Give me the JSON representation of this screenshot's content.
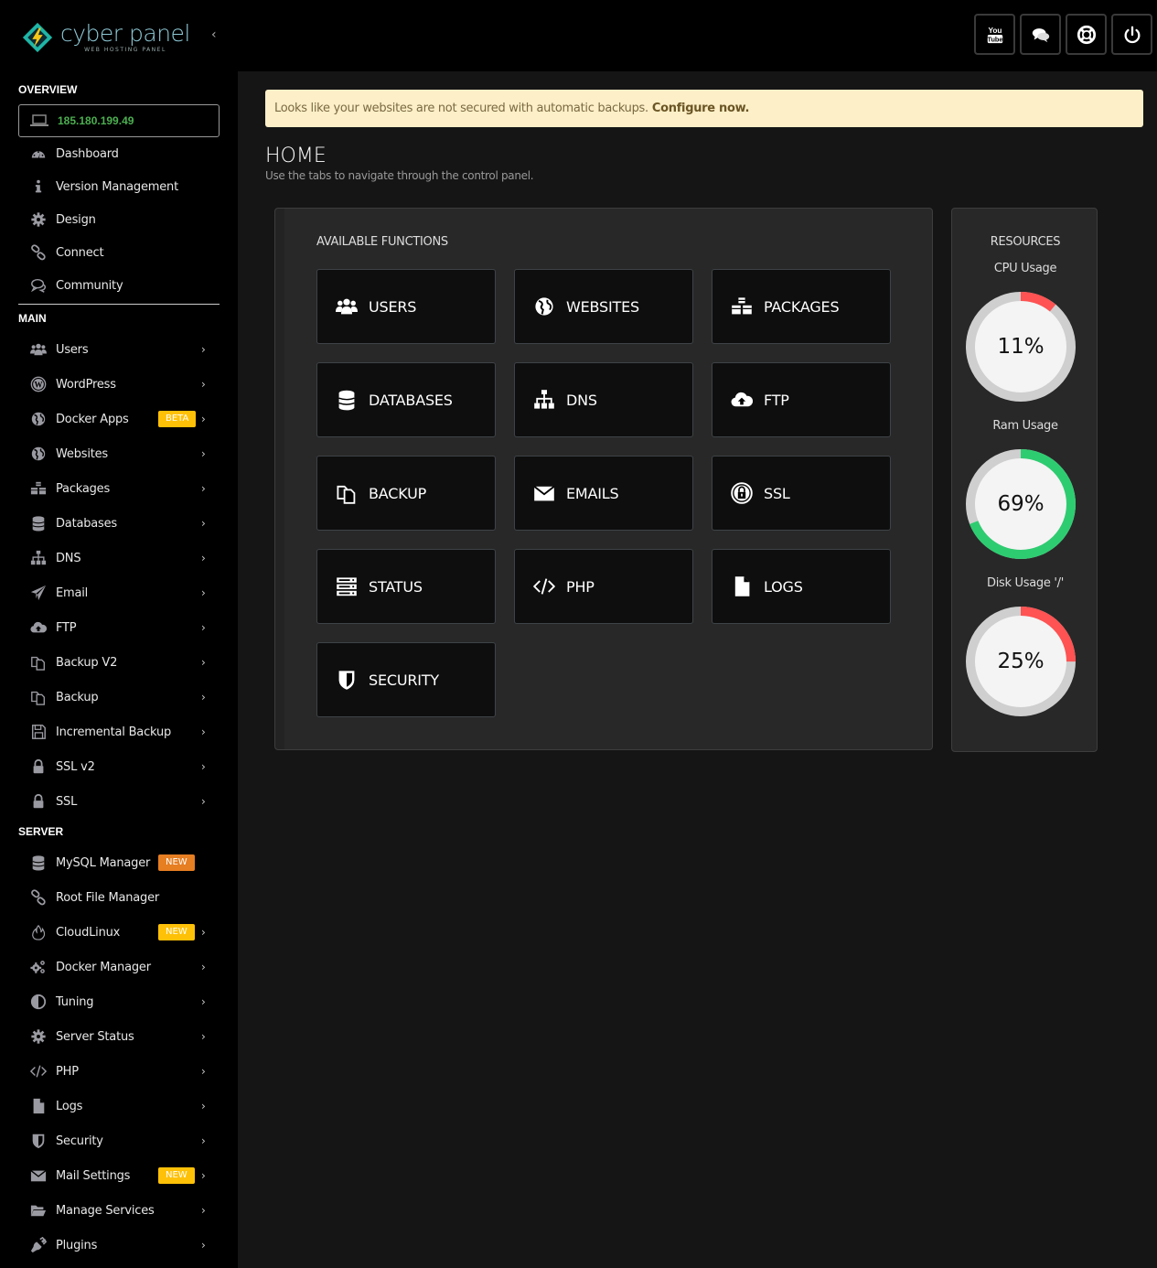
{
  "brand": {
    "name": "cyber panel",
    "tagline": "WEB HOSTING PANEL",
    "collapse_icon": "chevron-left-icon"
  },
  "top_actions": [
    {
      "name": "youtube-button",
      "icon": "youtube-icon"
    },
    {
      "name": "community-chat-button",
      "icon": "chat-bubbles-icon"
    },
    {
      "name": "support-button",
      "icon": "lifebuoy-icon"
    },
    {
      "name": "logout-button",
      "icon": "power-icon"
    }
  ],
  "sidebar": {
    "overview_title": "OVERVIEW",
    "ip_address": "185.180.199.49",
    "overview_items": [
      {
        "label": "Dashboard",
        "icon": "dashboard-gauge-icon"
      },
      {
        "label": "Version Management",
        "icon": "info-icon"
      },
      {
        "label": "Design",
        "icon": "gear-icon"
      },
      {
        "label": "Connect",
        "icon": "link-icon"
      },
      {
        "label": "Community",
        "icon": "comments-icon"
      }
    ],
    "main_title": "MAIN",
    "main_items": [
      {
        "label": "Users",
        "icon": "users-icon"
      },
      {
        "label": "WordPress",
        "icon": "wordpress-icon"
      },
      {
        "label": "Docker Apps",
        "icon": "globe-icon",
        "badge": "BETA"
      },
      {
        "label": "Websites",
        "icon": "globe-icon"
      },
      {
        "label": "Packages",
        "icon": "cubes-icon"
      },
      {
        "label": "Databases",
        "icon": "database-icon"
      },
      {
        "label": "DNS",
        "icon": "sitemap-icon"
      },
      {
        "label": "Email",
        "icon": "paper-plane-icon"
      },
      {
        "label": "FTP",
        "icon": "cloud-upload-icon"
      },
      {
        "label": "Backup V2",
        "icon": "copy-icon"
      },
      {
        "label": "Backup",
        "icon": "copy-icon"
      },
      {
        "label": "Incremental Backup",
        "icon": "save-icon"
      },
      {
        "label": "SSL v2",
        "icon": "lock-icon"
      },
      {
        "label": "SSL",
        "icon": "lock-icon"
      }
    ],
    "server_title": "SERVER",
    "server_items": [
      {
        "label": "MySQL Manager",
        "icon": "database-icon",
        "badge": "NEW"
      },
      {
        "label": "Root File Manager",
        "icon": "link-icon"
      },
      {
        "label": "CloudLinux",
        "icon": "fire-icon",
        "badge": "NEW"
      },
      {
        "label": "Docker Manager",
        "icon": "cogs-icon"
      },
      {
        "label": "Tuning",
        "icon": "adjust-icon"
      },
      {
        "label": "Server Status",
        "icon": "gear-icon"
      },
      {
        "label": "PHP",
        "icon": "code-icon"
      },
      {
        "label": "Logs",
        "icon": "file-icon"
      },
      {
        "label": "Security",
        "icon": "shield-icon"
      },
      {
        "label": "Mail Settings",
        "icon": "envelope-icon",
        "badge": "NEW"
      },
      {
        "label": "Manage Services",
        "icon": "folder-open-icon"
      },
      {
        "label": "Plugins",
        "icon": "plug-icon"
      }
    ]
  },
  "alert": {
    "text": "Looks like your websites are not secured with automatic backups.",
    "link": "Configure now."
  },
  "page": {
    "title": "HOME",
    "subtitle": "Use the tabs to navigate through the control panel."
  },
  "functions": {
    "title": "AVAILABLE FUNCTIONS",
    "tiles": [
      {
        "label": "USERS",
        "icon": "users-icon"
      },
      {
        "label": "WEBSITES",
        "icon": "globe-icon"
      },
      {
        "label": "PACKAGES",
        "icon": "cubes-icon"
      },
      {
        "label": "DATABASES",
        "icon": "database-icon"
      },
      {
        "label": "DNS",
        "icon": "sitemap-icon"
      },
      {
        "label": "FTP",
        "icon": "cloud-upload-icon"
      },
      {
        "label": "BACKUP",
        "icon": "copy-icon"
      },
      {
        "label": "EMAILS",
        "icon": "envelope-icon"
      },
      {
        "label": "SSL",
        "icon": "lock-circle-icon"
      },
      {
        "label": "STATUS",
        "icon": "server-icon"
      },
      {
        "label": "PHP",
        "icon": "code-icon"
      },
      {
        "label": "LOGS",
        "icon": "file-icon"
      },
      {
        "label": "SECURITY",
        "icon": "shield-icon"
      }
    ]
  },
  "resources": {
    "title": "RESOURCES",
    "gauges": [
      {
        "label": "CPU Usage",
        "percent": 11,
        "display": "11%",
        "color": "#ff5252"
      },
      {
        "label": "Ram Usage",
        "percent": 69,
        "display": "69%",
        "color": "#2ecc71"
      },
      {
        "label": "Disk Usage '/'",
        "percent": 25,
        "display": "25%",
        "color": "#ff5252"
      }
    ]
  },
  "colors": {
    "accent_green": "#4caf50",
    "badge_yellow": "#ffc107",
    "badge_orange": "#e67e22",
    "alert_bg": "#fdefc7"
  }
}
